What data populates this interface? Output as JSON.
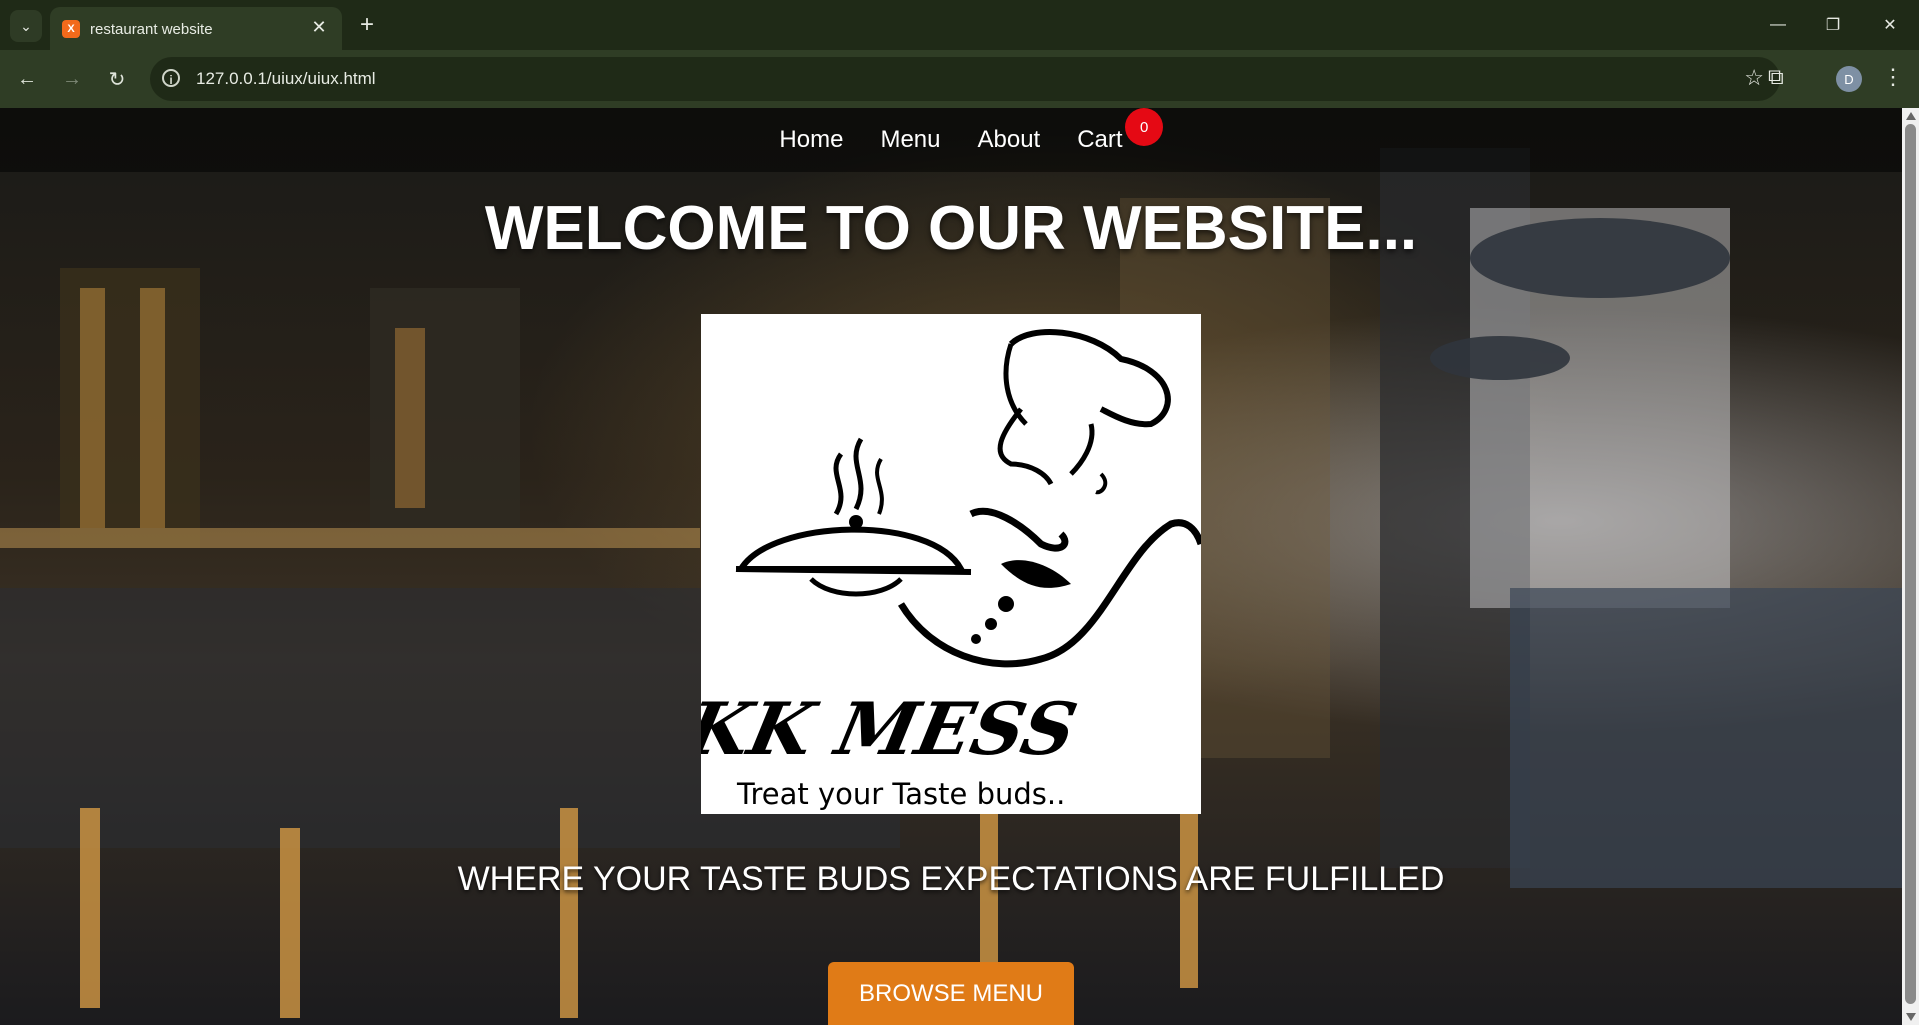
{
  "browser": {
    "tab_title": "restaurant website",
    "url": "127.0.0.1/uiux/uiux.html",
    "profile_initial": "D"
  },
  "nav": {
    "items": [
      {
        "label": "Home"
      },
      {
        "label": "Menu"
      },
      {
        "label": "About"
      },
      {
        "label": "Cart"
      }
    ],
    "cart_count": "0"
  },
  "hero": {
    "title": "WELCOME TO OUR WEBSITE...",
    "tagline": "WHERE YOUR TASTE BUDS EXPECTATIONS ARE FULFILLED",
    "button_label": "BROWSE MENU"
  },
  "logo": {
    "brand": "KK MESS",
    "slogan": "Treat your Taste buds.."
  },
  "colors": {
    "accent": "#e07b17",
    "badge": "#e50914"
  },
  "icons": [
    "tab-search-icon",
    "close-icon",
    "plus-icon",
    "minimize-icon",
    "restore-icon",
    "back-icon",
    "forward-icon",
    "reload-icon",
    "info-icon",
    "star-icon",
    "extensions-icon",
    "more-icon"
  ]
}
